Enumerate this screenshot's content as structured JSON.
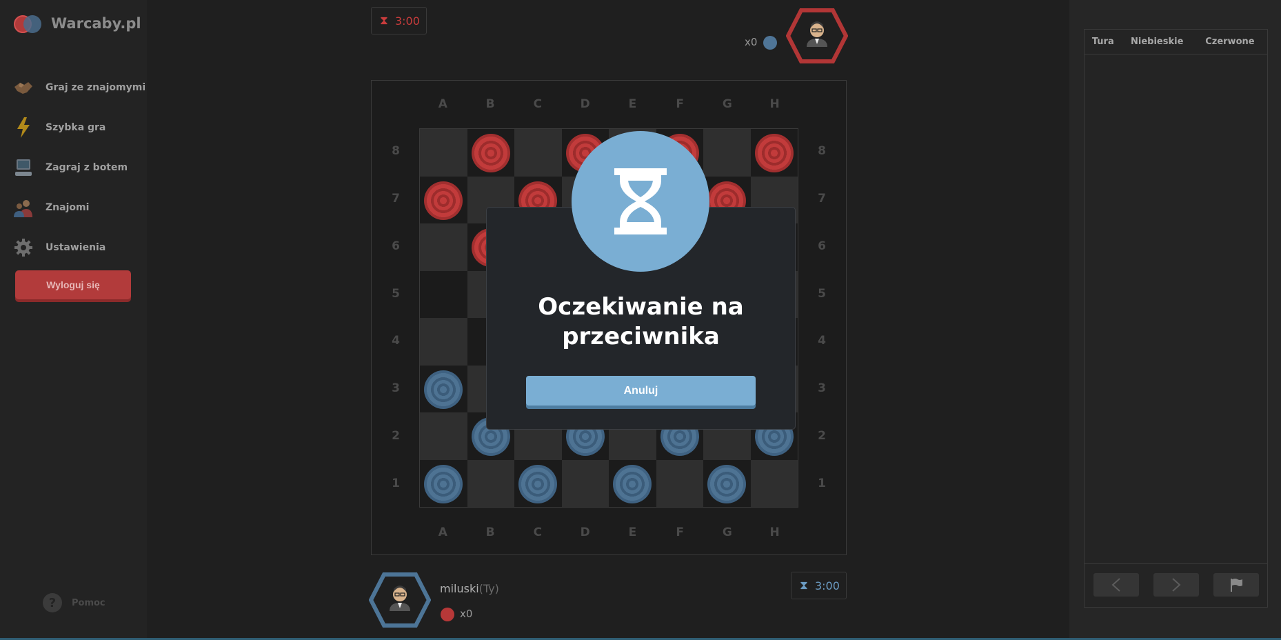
{
  "app": {
    "title": "Warcaby.pl"
  },
  "sidebar": {
    "items": [
      {
        "label": "Graj ze znajomymi",
        "icon": "handshake-icon"
      },
      {
        "label": "Szybka gra",
        "icon": "lightning-icon"
      },
      {
        "label": "Zagraj z botem",
        "icon": "computer-icon"
      },
      {
        "label": "Znajomi",
        "icon": "friends-icon"
      },
      {
        "label": "Ustawienia",
        "icon": "gear-icon"
      }
    ],
    "logout_label": "Wyloguj się",
    "help_label": "Pomoc"
  },
  "opponent": {
    "timer": "3:00",
    "captured": "x0"
  },
  "player": {
    "name": "miluski",
    "tag": "(Ty)",
    "timer": "3:00",
    "captured": "x0"
  },
  "board": {
    "files": [
      "A",
      "B",
      "C",
      "D",
      "E",
      "F",
      "G",
      "H"
    ],
    "ranks": [
      "8",
      "7",
      "6",
      "5",
      "4",
      "3",
      "2",
      "1"
    ],
    "pieces": [
      [
        "",
        "red",
        "",
        "red",
        "",
        "red",
        "",
        "red"
      ],
      [
        "red",
        "",
        "red",
        "",
        "red",
        "",
        "red",
        ""
      ],
      [
        "",
        "red",
        "",
        "red",
        "",
        "red",
        "",
        "red"
      ],
      [
        "",
        "",
        "",
        "",
        "",
        "",
        "",
        ""
      ],
      [
        "",
        "",
        "",
        "",
        "",
        "",
        "",
        ""
      ],
      [
        "blue",
        "",
        "blue",
        "",
        "blue",
        "",
        "blue",
        ""
      ],
      [
        "",
        "blue",
        "",
        "blue",
        "",
        "blue",
        "",
        "blue"
      ],
      [
        "blue",
        "",
        "blue",
        "",
        "blue",
        "",
        "blue",
        ""
      ]
    ]
  },
  "modal": {
    "title_line1": "Oczekiwanie na",
    "title_line2": "przeciwnika",
    "cancel_label": "Anuluj",
    "icon": "hourglass-icon"
  },
  "moves_panel": {
    "headers": [
      "Tura",
      "Niebieskie",
      "Czerwone"
    ]
  },
  "colors": {
    "red_piece": "#c23b3b",
    "blue_piece": "#4e7393",
    "modal_accent": "#7aaed3",
    "logout": "#b23b3b"
  }
}
